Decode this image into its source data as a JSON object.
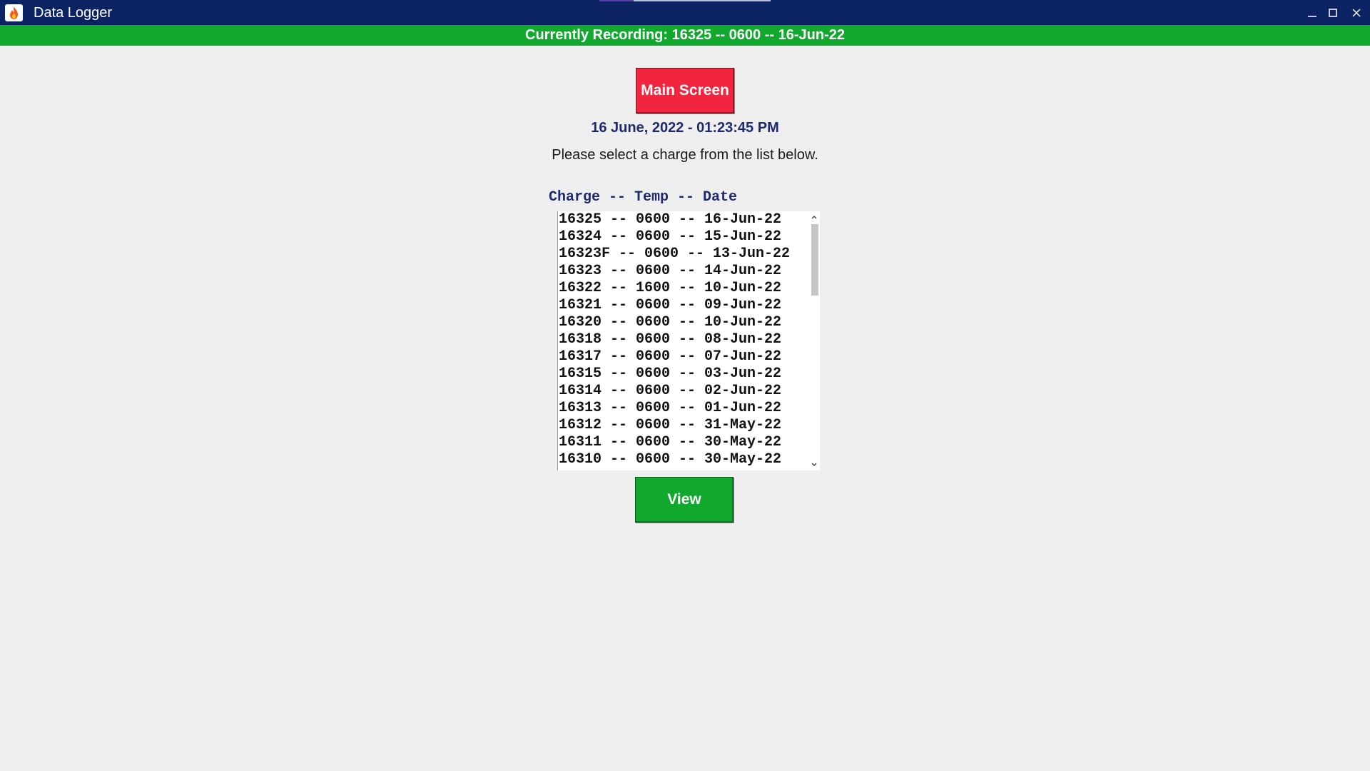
{
  "window": {
    "title": "Data Logger",
    "icon": "flame-icon",
    "controls": [
      "minimize-icon",
      "maximize-icon",
      "close-icon"
    ]
  },
  "recording_banner": "Currently Recording: 16325 -- 0600 -- 16-Jun-22",
  "main_screen_label": "Main Screen",
  "datetime": "16 June, 2022 - 01:23:45 PM",
  "instruction": "Please select a charge from the list below.",
  "list": {
    "header": "Charge -- Temp -- Date",
    "items": [
      "16325 -- 0600 -- 16-Jun-22",
      "16324 -- 0600 -- 15-Jun-22",
      "16323F -- 0600 -- 13-Jun-22",
      "16323 -- 0600 -- 14-Jun-22",
      "16322 -- 1600 -- 10-Jun-22",
      "16321 -- 0600 -- 09-Jun-22",
      "16320 -- 0600 -- 10-Jun-22",
      "16318 -- 0600 -- 08-Jun-22",
      "16317 -- 0600 -- 07-Jun-22",
      "16315 -- 0600 -- 03-Jun-22",
      "16314 -- 0600 -- 02-Jun-22",
      "16313 -- 0600 -- 01-Jun-22",
      "16312 -- 0600 -- 31-May-22",
      "16311 -- 0600 -- 30-May-22",
      "16310 -- 0600 -- 30-May-22"
    ]
  },
  "view_label": "View",
  "colors": {
    "titlebar": "#0b2263",
    "recording_bar": "#10a92e",
    "main_screen_button": "#f2253f",
    "view_button": "#10a92e",
    "heading_text": "#1f2a6e",
    "background": "#efefef"
  }
}
